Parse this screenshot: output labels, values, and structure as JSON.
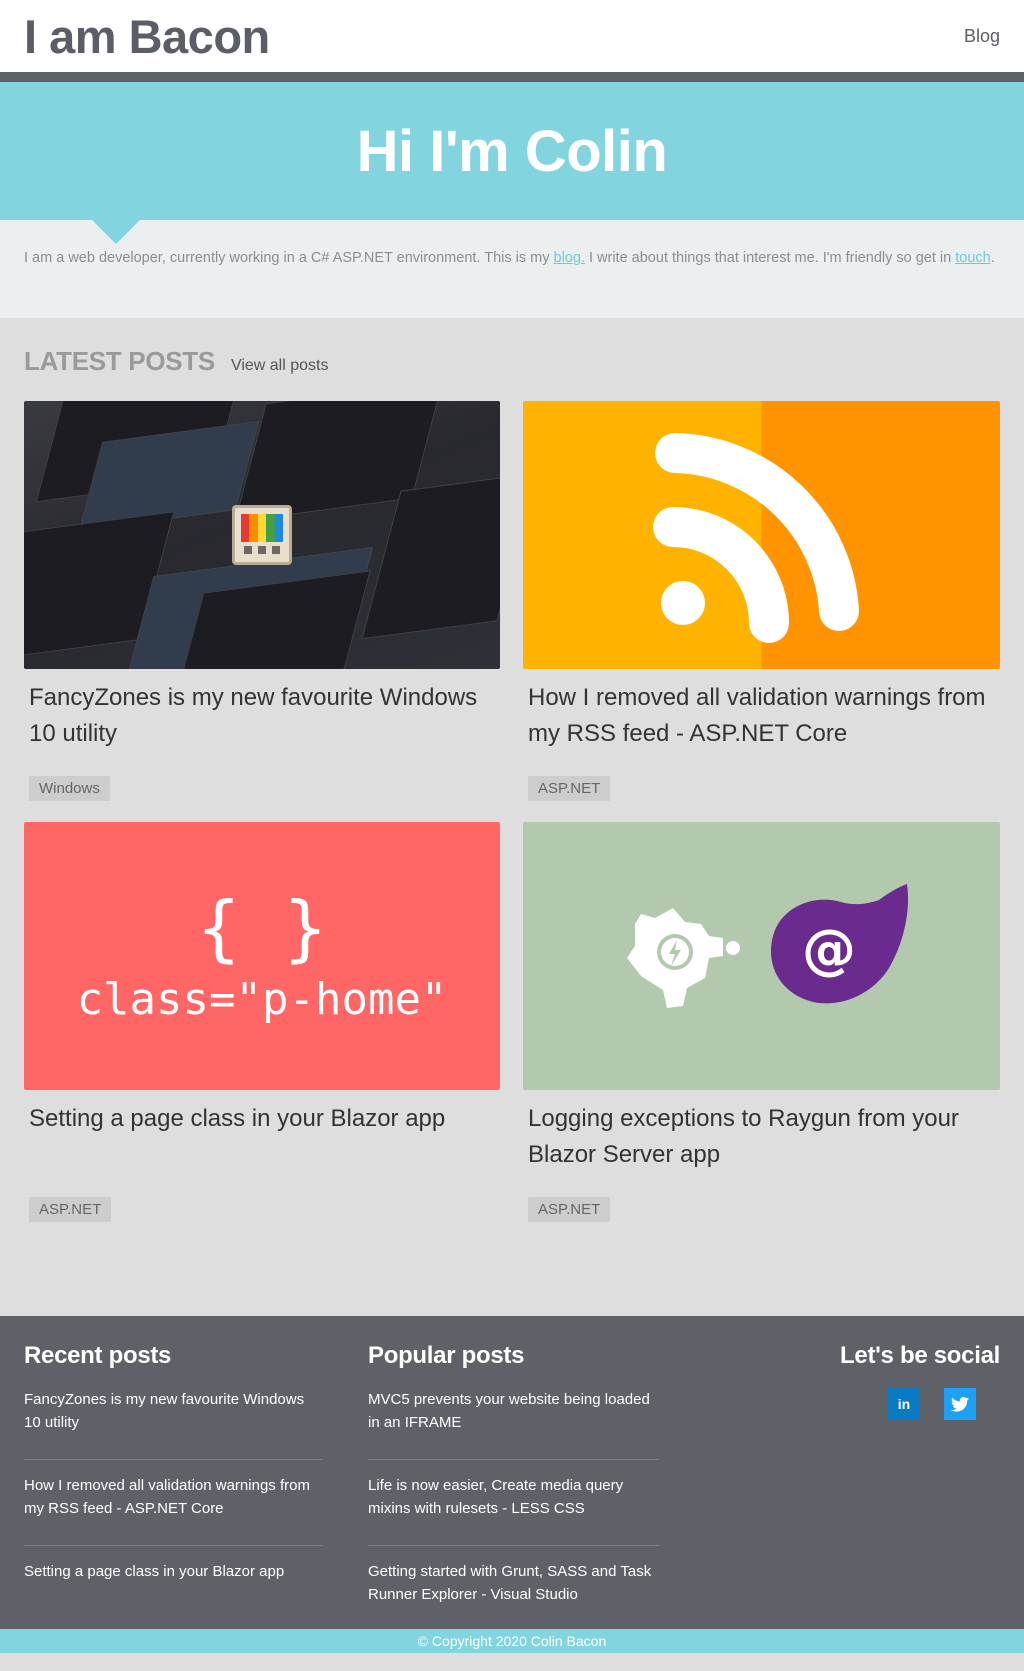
{
  "header": {
    "brand": "I am Bacon",
    "nav_blog": "Blog"
  },
  "hero": {
    "title": "Hi I'm Colin"
  },
  "intro": {
    "text_1": "I am a web developer, currently working in a C# ASP.NET environment. This is my ",
    "blog_link": "blog.",
    "text_2": " I write about things that interest me. I'm friendly so get in ",
    "touch_link": "touch",
    "text_3": "."
  },
  "latest": {
    "heading": "LATEST POSTS",
    "view_all": "View all posts",
    "posts": [
      {
        "title": "FancyZones is my new favourite Windows 10 utility",
        "tag": "Windows"
      },
      {
        "title": "How I removed all validation warnings from my RSS feed - ASP.NET Core",
        "tag": "ASP.NET"
      },
      {
        "title": "Setting a page class in your Blazor app",
        "tag": "ASP.NET",
        "thumb_braces": "{ }",
        "thumb_code": "class=\"p-home\""
      },
      {
        "title": "Logging exceptions to Raygun from your Blazor Server app",
        "tag": "ASP.NET"
      }
    ]
  },
  "footer": {
    "recent_heading": "Recent posts",
    "recent": [
      "FancyZones is my new favourite Windows 10 utility",
      "How I removed all validation warnings from my RSS feed - ASP.NET Core",
      "Setting a page class in your Blazor app"
    ],
    "popular_heading": "Popular posts",
    "popular": [
      "MVC5 prevents your website being loaded in an IFRAME",
      "Life is now easier, Create media query mixins with rulesets - LESS CSS",
      "Getting started with Grunt, SASS and Task Runner Explorer - Visual Studio"
    ],
    "social_heading": "Let's be social",
    "linkedin_label": "in",
    "copyright": "© Copyright 2020 Colin Bacon"
  },
  "colors": {
    "accent": "#82d4de",
    "dark": "#5f6168",
    "linkedin": "#0a7bc2",
    "twitter": "#1da1f2"
  },
  "icons": [
    "powertoys-icon",
    "rss-icon",
    "raygun-icon",
    "blazor-icon",
    "linkedin-icon",
    "twitter-icon"
  ]
}
